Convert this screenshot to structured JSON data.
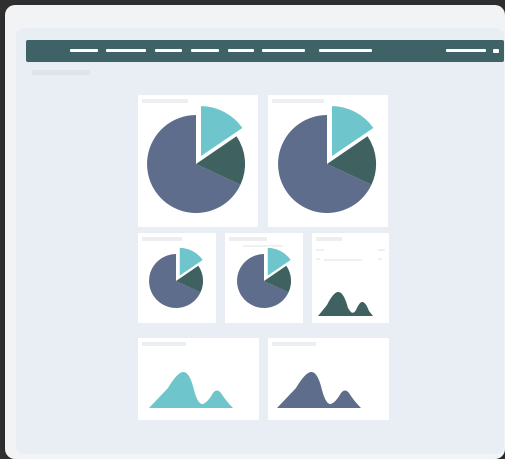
{
  "colors": {
    "pie_main": "#5e6d8c",
    "pie_mid": "#3f6261",
    "pie_accent": "#6ec6cc",
    "teal_area": "#6ec6cc",
    "slate_area": "#5e6d8c",
    "dark_area": "#3f6261",
    "topbar": "#3e6266"
  },
  "topbar": {
    "nav_items": 7,
    "right_items": 2
  },
  "cards": [
    {
      "type": "pie"
    },
    {
      "type": "pie"
    },
    {
      "type": "pie"
    },
    {
      "type": "pie"
    },
    {
      "type": "area"
    },
    {
      "type": "area"
    },
    {
      "type": "area"
    }
  ]
}
